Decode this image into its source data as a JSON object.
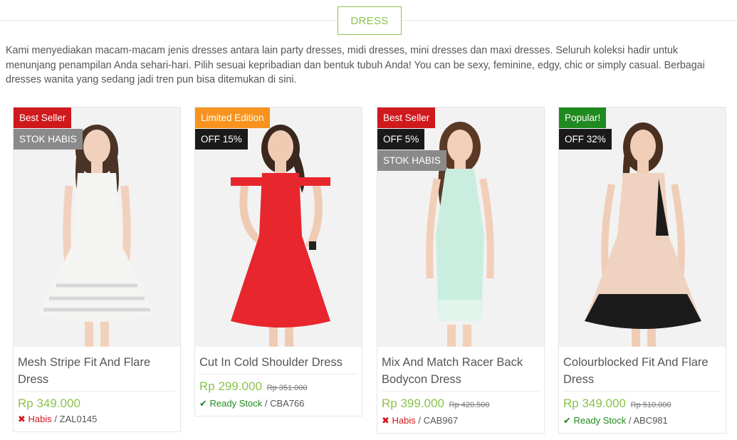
{
  "header": {
    "title": "DRESS"
  },
  "intro": "Kami menyediakan macam-macam jenis dresses antara lain party dresses, midi dresses, mini dresses dan maxi dresses. Seluruh koleksi hadir untuk menunjang penampilan Anda sehari-hari. Pilih sesuai kepribadian dan bentuk tubuh Anda! You can be sexy, feminine, edgy, chic or simply casual. Berbagai dresses wanita yang sedang jadi tren pun bisa ditemukan di sini.",
  "products": [
    {
      "name": "Mesh Stripe Fit And Flare Dress",
      "price": "Rp 349.000",
      "old_price": "",
      "badges": [
        {
          "text": "Best Seller",
          "color": "#d0191c"
        },
        {
          "text": "STOK HABIS",
          "color": "#8a8a8a"
        }
      ],
      "stock_icon": "cross-icon",
      "stock_label": "Habis",
      "sku": "ZAL0145",
      "dress_color": "#f4f4f2"
    },
    {
      "name": "Cut In Cold Shoulder Dress",
      "price": "Rp 299.000",
      "old_price": "Rp 351.000",
      "badges": [
        {
          "text": "Limited Edition",
          "color": "#f7931e"
        },
        {
          "text": "OFF 15%",
          "color": "#1a1a1a"
        }
      ],
      "stock_icon": "check-icon",
      "stock_label": "Ready Stock",
      "sku": "CBA766",
      "dress_color": "#e8262d"
    },
    {
      "name": "Mix And Match Racer Back Bodycon Dress",
      "price": "Rp 399.000",
      "old_price": "Rp 420.500",
      "badges": [
        {
          "text": "Best Seller",
          "color": "#d0191c"
        },
        {
          "text": "OFF 5%",
          "color": "#1a1a1a"
        },
        {
          "text": "STOK HABIS",
          "color": "#8a8a8a"
        }
      ],
      "stock_icon": "cross-icon",
      "stock_label": "Habis",
      "sku": "CAB967",
      "dress_color": "#c9eee0"
    },
    {
      "name": "Colourblocked Fit And Flare Dress",
      "price": "Rp 349.000",
      "old_price": "Rp 510.000",
      "badges": [
        {
          "text": "Popular!",
          "color": "#1f8a1f"
        },
        {
          "text": "OFF 32%",
          "color": "#1a1a1a"
        }
      ],
      "stock_icon": "check-icon",
      "stock_label": "Ready Stock",
      "sku": "ABC981",
      "dress_color": "#f0d2c0"
    }
  ],
  "separator": " / "
}
